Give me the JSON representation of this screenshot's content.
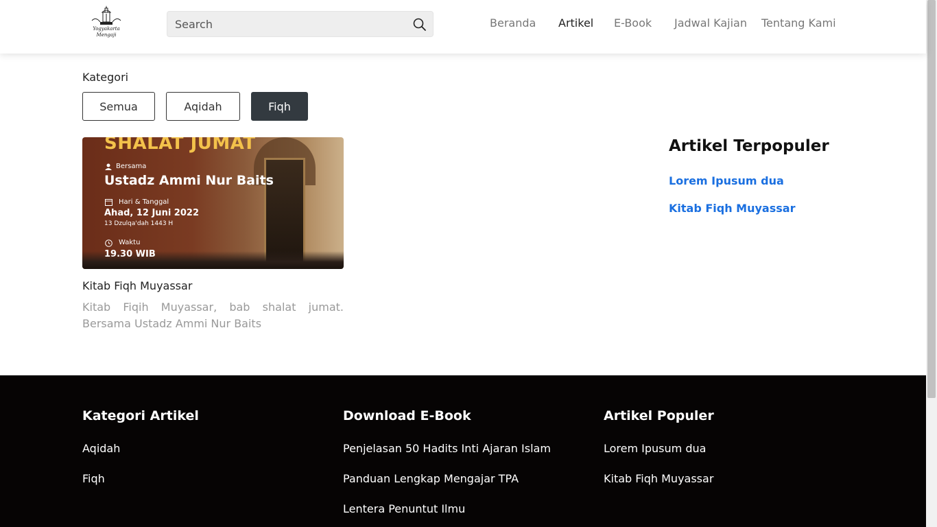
{
  "header": {
    "logo_line1": "Yogyakarta",
    "logo_line2": "Mengaji",
    "search_placeholder": "Search",
    "nav": [
      "Beranda",
      "Artikel",
      "E-Book",
      "Jadwal Kajian",
      "Tentang Kami"
    ],
    "active_nav": "Artikel"
  },
  "category": {
    "label": "Kategori",
    "buttons": [
      "Semua",
      "Aqidah",
      "Fiqh"
    ],
    "active": "Fiqh"
  },
  "article": {
    "image": {
      "headline": "SHALAT JUMAT",
      "with_label": "Bersama",
      "speaker": "Ustadz Ammi Nur Baits",
      "date_label": "Hari & Tanggal",
      "date": "Ahad, 12 Juni 2022",
      "hijri": "13 Dzulqa'dah 1443 H",
      "time_label": "Waktu",
      "time": "19.30 WIB"
    },
    "title": "Kitab Fiqh Muyassar",
    "description": "Kitab Fiqih Muyassar, bab shalat jumat. Bersama Ustadz Ammi Nur Baits"
  },
  "popular": {
    "title": "Artikel Terpopuler",
    "links": [
      "Lorem Ipusum dua",
      "Kitab Fiqh Muyassar"
    ]
  },
  "footer": {
    "col1": {
      "title": "Kategori Artikel",
      "links": [
        "Aqidah",
        "Fiqh"
      ]
    },
    "col2": {
      "title": "Download E-Book",
      "links": [
        "Penjelasan 50 Hadits Inti Ajaran Islam",
        "Panduan Lengkap Mengajar TPA",
        "Lentera Penuntut Ilmu"
      ]
    },
    "col3": {
      "title": "Artikel Populer",
      "links": [
        "Lorem Ipusum dua",
        "Kitab Fiqh Muyassar"
      ]
    }
  },
  "colors": {
    "link_blue": "#1a6fe0",
    "footer_bg": "#060404",
    "active_button": "#333a40",
    "headline_gold": "#f3c24b"
  },
  "icons": [
    "logo-mosque-icon",
    "search-icon",
    "user-icon",
    "calendar-icon",
    "clock-icon"
  ]
}
